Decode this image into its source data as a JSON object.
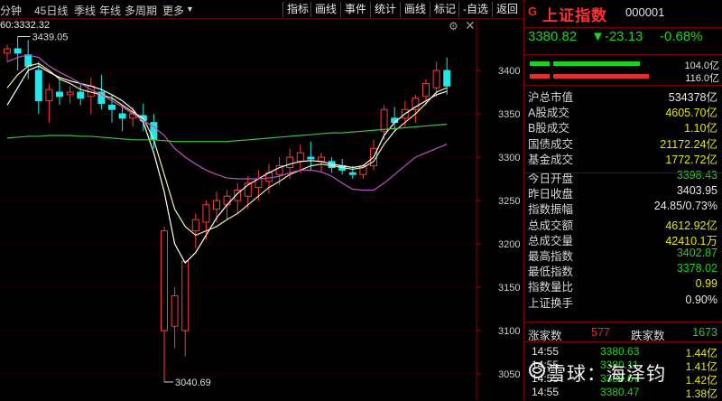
{
  "toolbar": {
    "periods": [
      "分钟",
      "45日线",
      "季线",
      "年线",
      "多周期",
      "更多"
    ],
    "tools": [
      "指标",
      "画线",
      "事件",
      "统计",
      "画线",
      "标记",
      "-自选",
      "返回"
    ]
  },
  "ma_legend": {
    "prefix": "60:",
    "value": "3332.32"
  },
  "annotations": {
    "high_label": "3439.05",
    "low_label": "3040.69"
  },
  "chart_data": {
    "type": "candlestick",
    "y_ticks": [
      3400,
      3350,
      3300,
      3250,
      3200,
      3150,
      3100,
      3050
    ],
    "ylim": [
      3030,
      3450
    ],
    "candles": [
      {
        "o": 3420,
        "h": 3430,
        "l": 3410,
        "c": 3425
      },
      {
        "o": 3425,
        "h": 3439.05,
        "l": 3400,
        "c": 3420
      },
      {
        "o": 3418,
        "h": 3435,
        "l": 3390,
        "c": 3405
      },
      {
        "o": 3400,
        "h": 3410,
        "l": 3350,
        "c": 3365
      },
      {
        "o": 3365,
        "h": 3385,
        "l": 3340,
        "c": 3378
      },
      {
        "o": 3375,
        "h": 3390,
        "l": 3360,
        "c": 3370
      },
      {
        "o": 3372,
        "h": 3382,
        "l": 3362,
        "c": 3375
      },
      {
        "o": 3375,
        "h": 3385,
        "l": 3360,
        "c": 3368
      },
      {
        "o": 3370,
        "h": 3392,
        "l": 3350,
        "c": 3382
      },
      {
        "o": 3375,
        "h": 3395,
        "l": 3355,
        "c": 3362
      },
      {
        "o": 3360,
        "h": 3372,
        "l": 3340,
        "c": 3355
      },
      {
        "o": 3350,
        "h": 3360,
        "l": 3330,
        "c": 3345
      },
      {
        "o": 3345,
        "h": 3358,
        "l": 3335,
        "c": 3350
      },
      {
        "o": 3348,
        "h": 3362,
        "l": 3330,
        "c": 3342
      },
      {
        "o": 3340,
        "h": 3350,
        "l": 3310,
        "c": 3320
      },
      {
        "o": 3100,
        "h": 3220,
        "l": 3040.69,
        "c": 3215
      },
      {
        "o": 3105,
        "h": 3150,
        "l": 3080,
        "c": 3140
      },
      {
        "o": 3100,
        "h": 3180,
        "l": 3070,
        "c": 3180
      },
      {
        "o": 3215,
        "h": 3235,
        "l": 3195,
        "c": 3228
      },
      {
        "o": 3225,
        "h": 3250,
        "l": 3205,
        "c": 3245
      },
      {
        "o": 3240,
        "h": 3260,
        "l": 3225,
        "c": 3250
      },
      {
        "o": 3245,
        "h": 3262,
        "l": 3228,
        "c": 3255
      },
      {
        "o": 3250,
        "h": 3270,
        "l": 3235,
        "c": 3262
      },
      {
        "o": 3255,
        "h": 3278,
        "l": 3240,
        "c": 3270
      },
      {
        "o": 3265,
        "h": 3285,
        "l": 3250,
        "c": 3275
      },
      {
        "o": 3272,
        "h": 3292,
        "l": 3258,
        "c": 3282
      },
      {
        "o": 3280,
        "h": 3300,
        "l": 3268,
        "c": 3290
      },
      {
        "o": 3288,
        "h": 3310,
        "l": 3275,
        "c": 3300
      },
      {
        "o": 3295,
        "h": 3315,
        "l": 3282,
        "c": 3305
      },
      {
        "o": 3300,
        "h": 3318,
        "l": 3285,
        "c": 3298
      },
      {
        "o": 3295,
        "h": 3305,
        "l": 3282,
        "c": 3300
      },
      {
        "o": 3295,
        "h": 3300,
        "l": 3282,
        "c": 3288
      },
      {
        "o": 3290,
        "h": 3298,
        "l": 3280,
        "c": 3285
      },
      {
        "o": 3282,
        "h": 3290,
        "l": 3275,
        "c": 3280
      },
      {
        "o": 3280,
        "h": 3292,
        "l": 3275,
        "c": 3290
      },
      {
        "o": 3290,
        "h": 3320,
        "l": 3285,
        "c": 3310
      },
      {
        "o": 3330,
        "h": 3360,
        "l": 3320,
        "c": 3355
      },
      {
        "o": 3345,
        "h": 3358,
        "l": 3330,
        "c": 3340
      },
      {
        "o": 3345,
        "h": 3365,
        "l": 3335,
        "c": 3355
      },
      {
        "o": 3355,
        "h": 3372,
        "l": 3340,
        "c": 3368
      },
      {
        "o": 3370,
        "h": 3390,
        "l": 3360,
        "c": 3385
      },
      {
        "o": 3380,
        "h": 3410,
        "l": 3370,
        "c": 3400
      },
      {
        "o": 3400,
        "h": 3415,
        "l": 3372,
        "c": 3382
      }
    ],
    "ma_lines": [
      {
        "color": "#f0f0a0",
        "values": [
          3380,
          3395,
          3405,
          3408,
          3400,
          3390,
          3385,
          3378,
          3375,
          3372,
          3368,
          3360,
          3352,
          3345,
          3320,
          3280,
          3240,
          3220,
          3210,
          3215,
          3220,
          3228,
          3235,
          3245,
          3255,
          3265,
          3272,
          3280,
          3285,
          3290,
          3292,
          3290,
          3288,
          3286,
          3288,
          3295,
          3315,
          3330,
          3340,
          3350,
          3362,
          3375,
          3380
        ]
      },
      {
        "color": "#ffffff",
        "values": [
          3360,
          3380,
          3400,
          3405,
          3398,
          3392,
          3388,
          3385,
          3382,
          3378,
          3372,
          3365,
          3355,
          3340,
          3305,
          3260,
          3200,
          3178,
          3190,
          3210,
          3230,
          3245,
          3258,
          3268,
          3275,
          3282,
          3288,
          3292,
          3295,
          3296,
          3295,
          3292,
          3290,
          3288,
          3290,
          3300,
          3325,
          3340,
          3350,
          3358,
          3365,
          3372,
          3376
        ]
      },
      {
        "color": "#c050c0",
        "values": [
          3410,
          3415,
          3418,
          3415,
          3405,
          3398,
          3392,
          3385,
          3378,
          3372,
          3365,
          3358,
          3350,
          3342,
          3335,
          3325,
          3310,
          3300,
          3292,
          3285,
          3280,
          3276,
          3275,
          3275,
          3275,
          3276,
          3278,
          3282,
          3285,
          3285,
          3283,
          3278,
          3270,
          3263,
          3262,
          3262,
          3270,
          3280,
          3290,
          3300,
          3305,
          3310,
          3315
        ]
      },
      {
        "color": "#40c040",
        "values": [
          3322,
          3323,
          3324,
          3324,
          3325,
          3325,
          3325,
          3324,
          3324,
          3323,
          3322,
          3321,
          3320,
          3320,
          3320,
          3319,
          3318,
          3318,
          3318,
          3318,
          3318,
          3318,
          3319,
          3320,
          3321,
          3322,
          3323,
          3324,
          3325,
          3326,
          3327,
          3328,
          3328,
          3329,
          3330,
          3331,
          3332,
          3333,
          3334,
          3335,
          3336,
          3337,
          3338
        ]
      }
    ]
  },
  "panel": {
    "g": "G",
    "name": "上证指数",
    "code": "000001",
    "price": "3380.82",
    "change": "▼-23.13",
    "pct": "-0.68%",
    "bar_top": "104.0亿",
    "bar_bottom": "116.0亿",
    "rows": [
      {
        "label": "沪总市值",
        "value": "534378亿",
        "cls": "w"
      },
      {
        "label": "A股成交",
        "value": "4605.70亿",
        "cls": "y"
      },
      {
        "label": "B股成交",
        "value": "1.10亿",
        "cls": "y"
      },
      {
        "label": "国债成交",
        "value": "21172.24亿",
        "cls": "y"
      },
      {
        "label": "基金成交",
        "value": "1772.72亿",
        "cls": "y"
      },
      {
        "label": "今日开盘",
        "value": "3398.43",
        "cls": "g"
      },
      {
        "label": "昨日收盘",
        "value": "3403.95",
        "cls": "w"
      },
      {
        "label": "指数振幅",
        "value": "24.85/0.73%",
        "cls": "w"
      },
      {
        "label": "总成交额",
        "value": "4612.92亿",
        "cls": "y"
      },
      {
        "label": "总成交量",
        "value": "42410.1万",
        "cls": "y"
      },
      {
        "label": "最高指数",
        "value": "3402.87",
        "cls": "g"
      },
      {
        "label": "最低指数",
        "value": "3378.02",
        "cls": "g"
      },
      {
        "label": "指数量比",
        "value": "0.99",
        "cls": "y"
      },
      {
        "label": "上证换手",
        "value": "0.90%",
        "cls": "w"
      }
    ],
    "stats": {
      "up_label": "涨家数",
      "up_value": "577",
      "down_label": "跌家数",
      "down_value": "1673"
    },
    "ticks": [
      {
        "time": "14:55",
        "price": "3380.63",
        "vol": "1.44亿"
      },
      {
        "time": "14:55",
        "price": "3380.11",
        "vol": "1.41亿"
      },
      {
        "time": "14:55",
        "price": "3380.67",
        "vol": "1.42亿"
      },
      {
        "time": "14:55",
        "price": "3380.47",
        "vol": "1.38亿"
      }
    ]
  },
  "watermark": "雪球：海泽钧"
}
